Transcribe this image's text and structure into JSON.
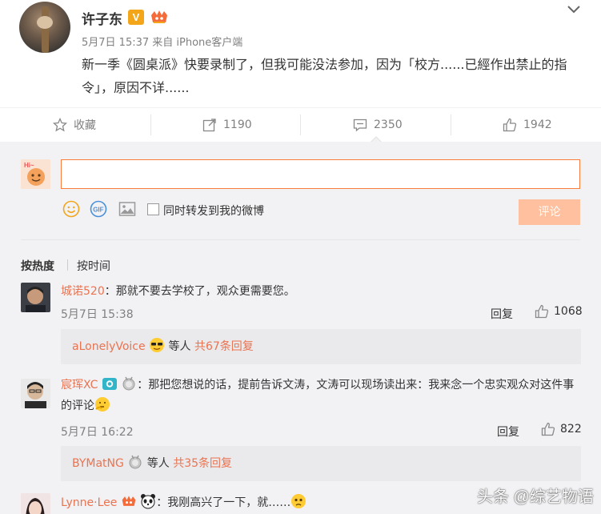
{
  "post": {
    "username": "许子东",
    "v_badge": "V",
    "meta": "5月7日 15:37 来自 iPhone客户端",
    "text": "新一季《圆桌派》快要录制了，但我可能没法参加，因为「校方......已經作出禁止的指令」，原因不详......"
  },
  "actions": {
    "favorite": {
      "label": "收藏",
      "icon": "star-icon"
    },
    "repost": {
      "count": "1190",
      "icon": "share-icon"
    },
    "comment": {
      "count": "2350",
      "icon": "comment-icon"
    },
    "like": {
      "count": "1942",
      "icon": "thumbs-up-icon"
    }
  },
  "composer": {
    "input_value": "",
    "forward_label": "同时转发到我的微博",
    "submit_label": "评论",
    "tools": [
      "smiley-icon",
      "gif-icon",
      "image-icon"
    ],
    "accent": "#fa7d3c",
    "submit_color": "#ffc09f"
  },
  "sort": {
    "hot": "按热度",
    "time": "按时间"
  },
  "comments": [
    {
      "name": "城诺520",
      "text": "：那就不要去学校了，观众更需要您。",
      "time": "5月7日 15:38",
      "reply": "回复",
      "likes": "1068",
      "sub": {
        "name": "aLonelyVoice",
        "mid": " 等人 ",
        "count": "共67条回复"
      }
    },
    {
      "name": "宸珲XC",
      "text": "：那把您想说的话，提前告诉文涛，文涛可以现场读出来：我来念一个忠实观众对这件事的评论",
      "time": "5月7日 16:22",
      "reply": "回复",
      "likes": "822",
      "sub": {
        "name": "BYMatNG",
        "mid": " 等人 ",
        "count": "共35条回复"
      }
    },
    {
      "name": "Lynne·Lee",
      "text": "：我刚高兴了一下，就……"
    }
  ],
  "watermark": "头条 @综艺物语",
  "colors": {
    "name": "#eb7350",
    "background": "#f2f2f5",
    "vip": "#f3a61a"
  }
}
